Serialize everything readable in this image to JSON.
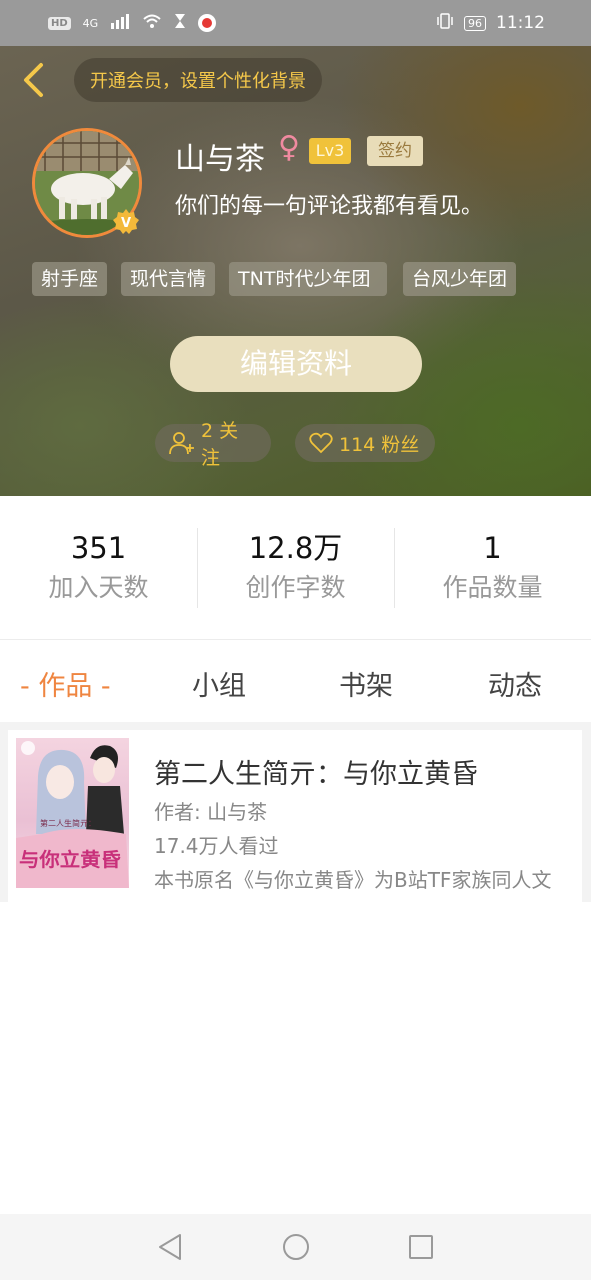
{
  "status_bar": {
    "hd": "HD",
    "hd_sub": "1",
    "network": "4G",
    "time": "11:12",
    "battery": "96"
  },
  "header": {
    "vip_prompt": "开通会员，设置个性化背景",
    "name": "山与茶",
    "gender_symbol": "♀",
    "level": "Lv3",
    "signed_label": "签约",
    "bio": "你们的每一句评论我都有看见。",
    "tags": [
      "射手座",
      "现代言情",
      "TNT时代少年团",
      "台风少年团"
    ],
    "edit_button": "编辑资料",
    "following": "2 关注",
    "fans": "114 粉丝"
  },
  "stats": [
    {
      "value": "351",
      "label": "加入天数"
    },
    {
      "value": "12.8万",
      "label": "创作字数"
    },
    {
      "value": "1",
      "label": "作品数量"
    }
  ],
  "tabs": {
    "works": "- 作品 -",
    "group": "小组",
    "shelf": "书架",
    "feed": "动态"
  },
  "books": [
    {
      "cover_title_top": "第二人生简亓：",
      "cover_title_main": "与你立黄昏",
      "title": "第二人生简亓：与你立黄昏",
      "author": "作者: 山与茶",
      "views": "17.4万人看过",
      "description": "本书原名《与你立黄昏》为B站TF家族同人文"
    }
  ],
  "colors": {
    "accent": "#ef8540",
    "gold": "#f0c23a"
  }
}
